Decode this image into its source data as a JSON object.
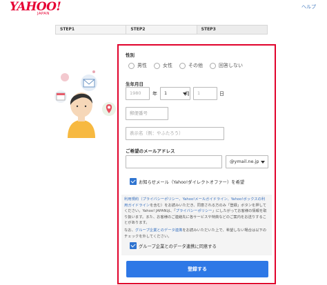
{
  "header": {
    "logo_text": "YAHOO!",
    "logo_sub": "JAPAN",
    "help": "ヘルプ"
  },
  "steps": [
    "STEP1",
    "STEP2",
    "STEP3"
  ],
  "form": {
    "gender": {
      "label": "性別",
      "options": [
        "男性",
        "女性",
        "その他",
        "回答しない"
      ]
    },
    "birth": {
      "label": "生年月日",
      "year_placeholder": "1980",
      "year_unit": "年",
      "month_value": "1",
      "month_unit": "月",
      "day_placeholder": "1",
      "day_unit": "日"
    },
    "postal_placeholder": "郵便番号",
    "display_name_placeholder": "表示名（例：やふたろう）",
    "email": {
      "label": "ご希望のメールアドレス",
      "domain": "@ymail.ne.jp"
    },
    "newsletter_label": "お知らせメール（Yahoo!ダイレクトオファー）を希望",
    "terms": {
      "line1_links": "利用規約（プライバシーポリシー、Yahoo!メールガイドライン、Yahoo!ボックスの利用ガイドライン",
      "line1_rest": "を含む）をお読みいただき、同意される方のみ「登録」ボタンを押してください。Yahoo! JAPANは、「",
      "policy_link": "プライバシーポリシー",
      "line1_end": "」にしたがってお客様の情報を取り扱います。また、お客様のご連絡先に各サービスや特典などのご案内をお送りすることがあります。",
      "line2_pre": "なお、",
      "group_link": "グループ企業とのデータ連携",
      "line2_rest": "をお読みいただいた上で、希望しない場合は以下のチェックを外してください。"
    },
    "group_consent_label": "グループ企業とのデータ連携に同意する",
    "submit_label": "登録する"
  }
}
